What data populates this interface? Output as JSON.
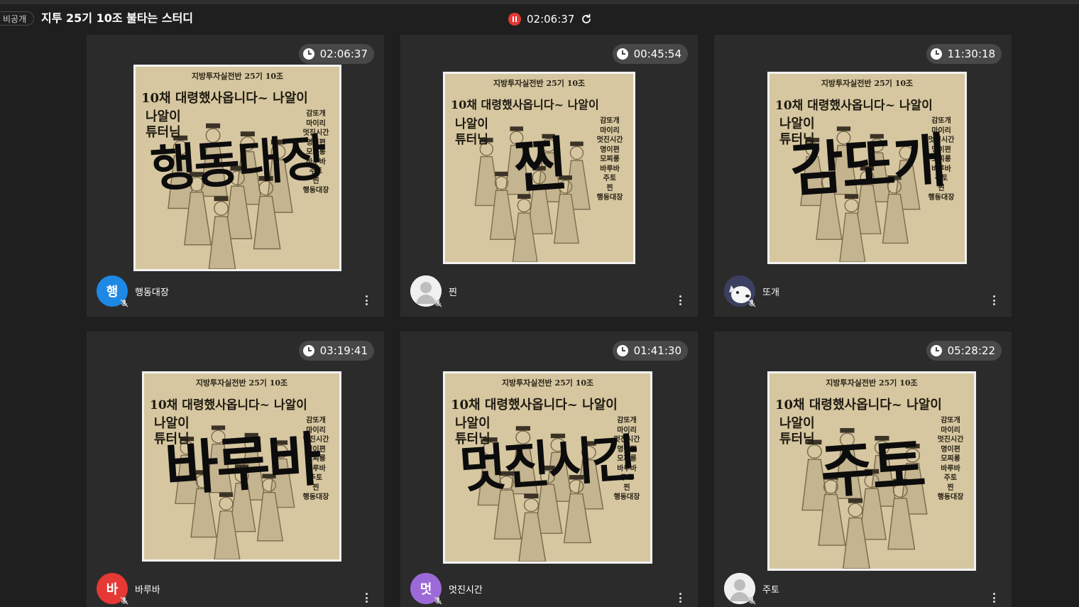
{
  "header": {
    "privacy_label": "비공개",
    "room_title": "지투 25기 10조 불타는 스터디",
    "recording_time": "02:06:37"
  },
  "poster": {
    "subtitle": "지방투자실전반 25기 10조",
    "headline": "10채 대령했사옵니다~ 나알이",
    "left_text": [
      "나알이",
      "튜터님"
    ],
    "name_list": [
      "감또개",
      "마이리",
      "멋진시간",
      "명이편",
      "모찌롱",
      "바루바",
      "주토",
      "찐",
      "행동대장"
    ]
  },
  "participants": [
    {
      "name": "행동대장",
      "timer": "02:06:37",
      "avatar_text": "행",
      "avatar_color": "#1e88e5",
      "avatar_type": "letter",
      "poster_big": "행동대장"
    },
    {
      "name": "찐",
      "timer": "00:45:54",
      "avatar_text": "",
      "avatar_color": "#e6e6e6",
      "avatar_type": "default-person-icon",
      "poster_big": "찐"
    },
    {
      "name": "또개",
      "timer": "11:30:18",
      "avatar_text": "",
      "avatar_color": "#3a3f55",
      "avatar_type": "cartoon-dog-icon",
      "poster_big": "감또개"
    },
    {
      "name": "바루바",
      "timer": "03:19:41",
      "avatar_text": "바",
      "avatar_color": "#e53935",
      "avatar_type": "letter",
      "poster_big": "바루바"
    },
    {
      "name": "멋진시간",
      "timer": "01:41:30",
      "avatar_text": "멋",
      "avatar_color": "#9c6ad8",
      "avatar_type": "letter",
      "poster_big": "멋진시간"
    },
    {
      "name": "주토",
      "timer": "05:28:22",
      "avatar_text": "",
      "avatar_color": "#e6e6e6",
      "avatar_type": "default-person-icon",
      "poster_big": "주토"
    }
  ]
}
